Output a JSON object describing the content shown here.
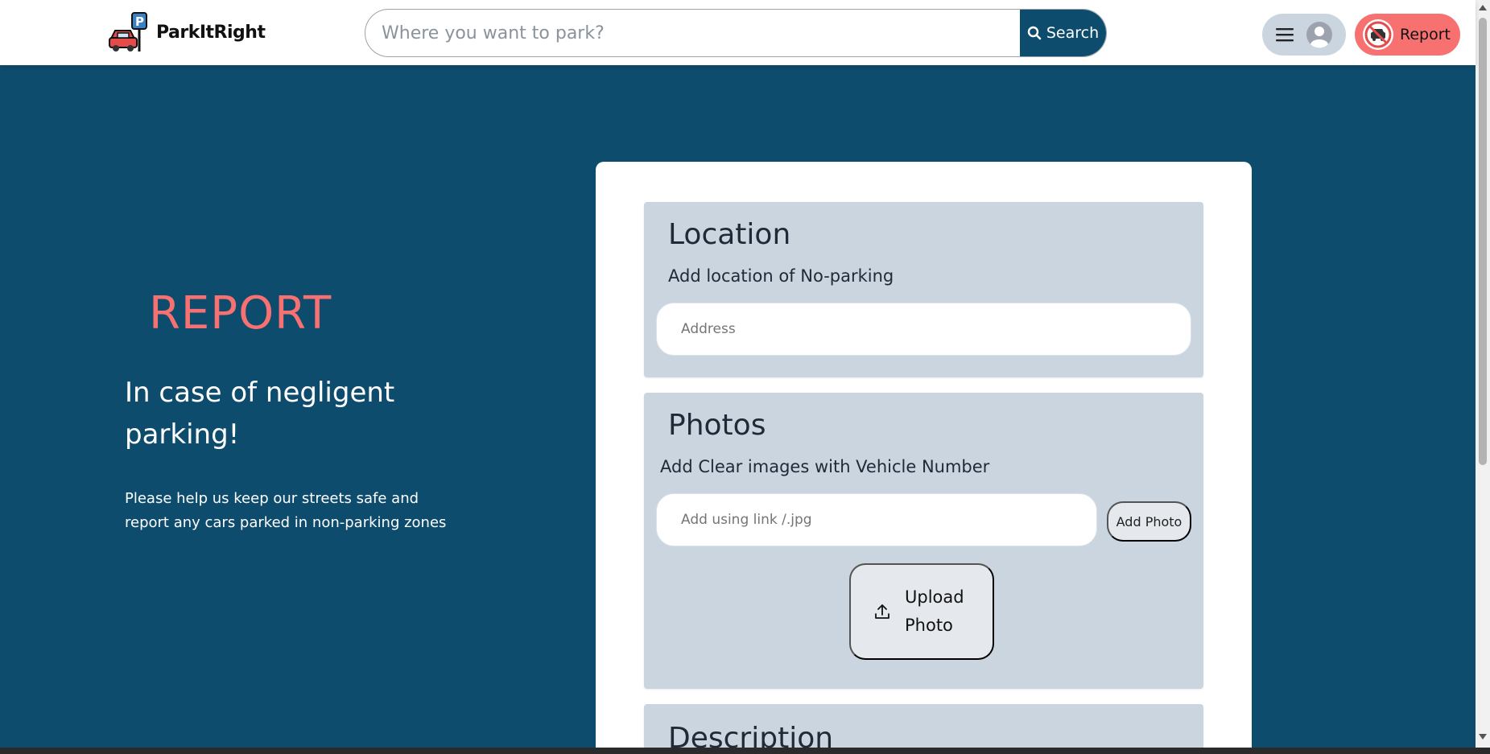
{
  "header": {
    "logo_text": "ParkItRight",
    "search_placeholder": "Where you want to park?",
    "search_button": "Search",
    "report_button": "Report"
  },
  "hero": {
    "title": "REPORT",
    "subtitle": "In case of negligent parking!",
    "text": "Please help us keep our streets safe and report any cars parked in non-parking zones"
  },
  "form": {
    "location": {
      "title": "Location",
      "subtitle": "Add location of No-parking",
      "address_placeholder": "Address"
    },
    "photos": {
      "title": "Photos",
      "subtitle": "Add Clear images with Vehicle Number",
      "link_placeholder": "Add using link /.jpg",
      "add_photo": "Add Photo",
      "upload_photo": "Upload Photo"
    },
    "description": {
      "title": "Description"
    }
  },
  "colors": {
    "primary": "#0e4c6e",
    "accent": "#f87171",
    "section_bg": "#cbd5e0"
  },
  "icons": {
    "logo": "car-parking-icon",
    "search": "search-icon",
    "menu": "hamburger-icon",
    "avatar": "user-avatar-icon",
    "report": "no-car-icon",
    "upload": "upload-icon"
  }
}
